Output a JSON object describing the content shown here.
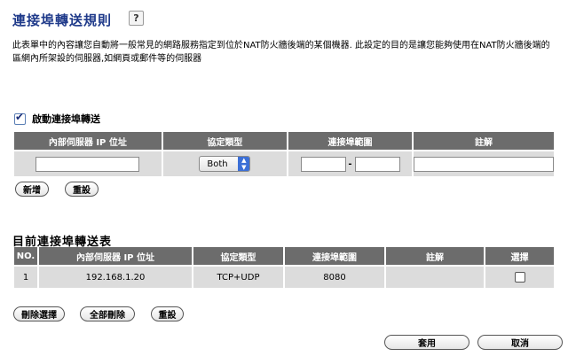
{
  "header": {
    "title": "連接埠轉送規則",
    "help_icon_label": "?"
  },
  "description": "此表單中的內容讓您自動將一般常見的網路服務指定到位於NAT防火牆後端的某個機器. 此設定的目的是讓您能夠使用在NAT防火牆後端的區網內所架設的伺服器,如網頁或郵件等的伺服器",
  "enable": {
    "label": "啟動連接埠轉送",
    "checked": true
  },
  "form_table": {
    "headers": [
      "內部伺服器 IP 位址",
      "協定類型",
      "連接埠範圍",
      "註解"
    ],
    "protocol_value": "Both",
    "port_separator": "-",
    "ip_value": "",
    "port_from_value": "",
    "port_to_value": "",
    "comment_value": ""
  },
  "form_buttons": {
    "add": "新增",
    "reset": "重設"
  },
  "current": {
    "title": "目前連接埠轉送表",
    "headers": [
      "NO.",
      "內部伺服器 IP 位址",
      "協定類型",
      "連接埠範圍",
      "註解",
      "選擇"
    ],
    "rows": [
      {
        "no": "1",
        "ip": "192.168.1.20",
        "protocol": "TCP+UDP",
        "port": "8080",
        "comment": ""
      }
    ]
  },
  "table_buttons": {
    "delete_selected": "刪除選擇",
    "delete_all": "全部刪除",
    "reset": "重設"
  },
  "footer_buttons": {
    "apply": "套用",
    "cancel": "取消"
  }
}
